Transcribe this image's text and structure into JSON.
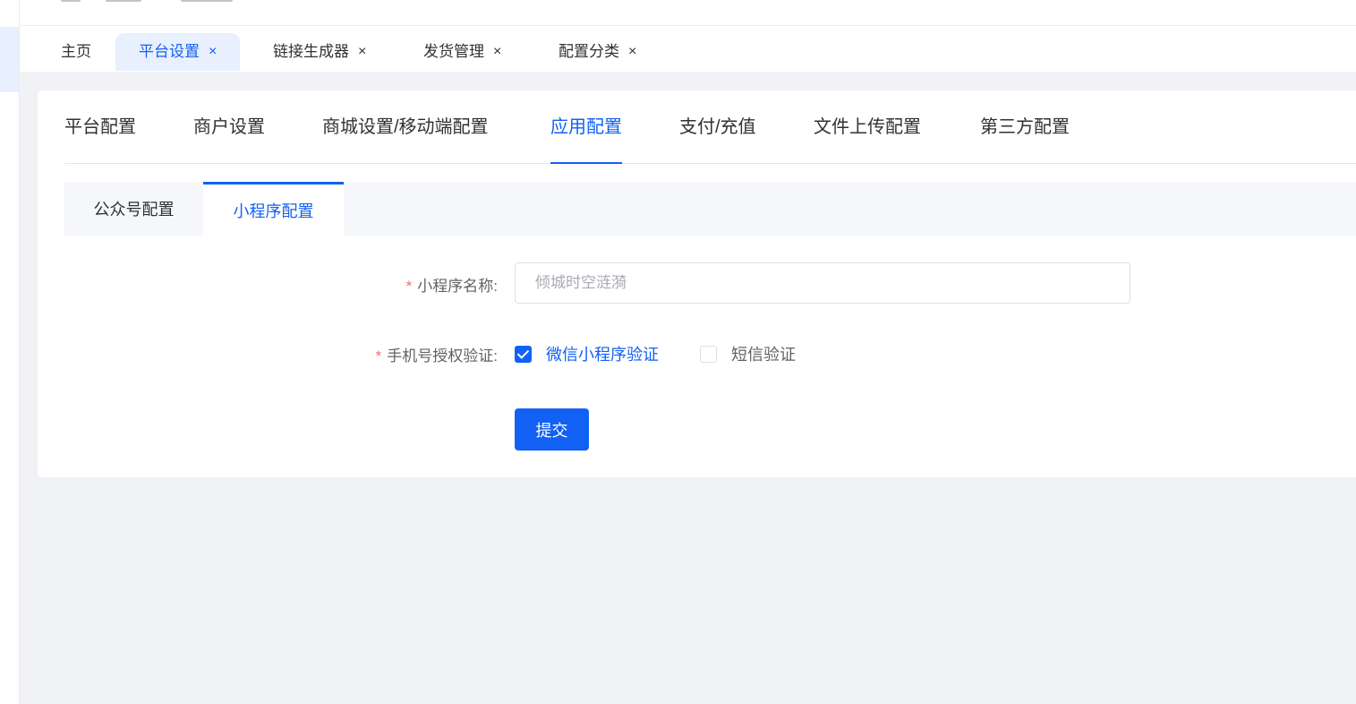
{
  "tag_bar": {
    "tags": [
      {
        "label": "主页",
        "closable": false
      },
      {
        "label": "平台设置",
        "closable": true,
        "active": true
      },
      {
        "label": "链接生成器",
        "closable": true
      },
      {
        "label": "发货管理",
        "closable": true
      },
      {
        "label": "配置分类",
        "closable": true
      }
    ],
    "close_glyph": "×"
  },
  "main_tabs": [
    "平台配置",
    "商户设置",
    "商城设置/移动端配置",
    "应用配置",
    "支付/充值",
    "文件上传配置",
    "第三方配置"
  ],
  "main_tabs_active": "应用配置",
  "sub_tabs": [
    "公众号配置",
    "小程序配置"
  ],
  "sub_tabs_active": "小程序配置",
  "form": {
    "required_mark": "*",
    "name_label": "小程序名称:",
    "name_placeholder": "倾城时空涟漪",
    "phone_auth_label": "手机号授权验证:",
    "options": [
      {
        "label": "微信小程序验证",
        "checked": true
      },
      {
        "label": "短信验证",
        "checked": false
      }
    ],
    "submit_label": "提交"
  },
  "colors": {
    "primary": "#1261f5",
    "required": "#f56c6c",
    "page_bg": "#f0f2f5"
  }
}
